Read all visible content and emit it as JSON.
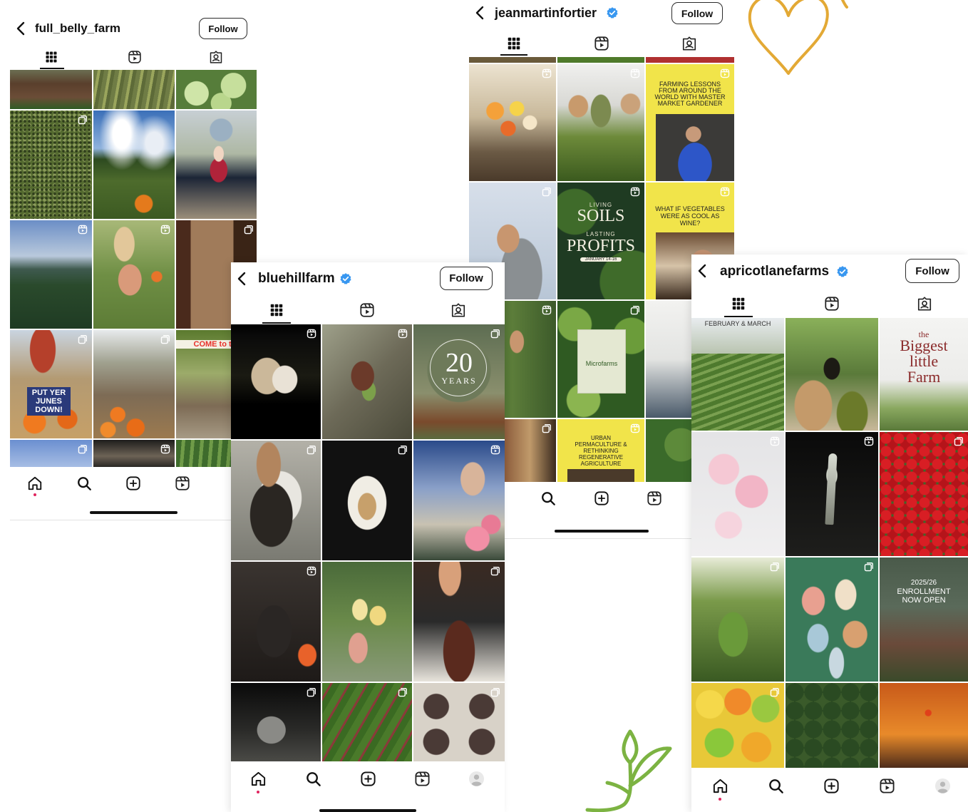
{
  "phones": {
    "full_belly_farm": {
      "username": "full_belly_farm",
      "follow_label": "Follow",
      "verified": false
    },
    "bluehillfarm": {
      "username": "bluehillfarm",
      "follow_label": "Follow",
      "verified": true
    },
    "jeanmartinfortier": {
      "username": "jeanmartinfortier",
      "follow_label": "Follow",
      "verified": true
    },
    "apricotlanefarms": {
      "username": "apricotlanefarms",
      "follow_label": "Follow",
      "verified": true
    }
  },
  "post_text": {
    "full_belly_tile10": "PUT YER JUNES DOWN!",
    "full_belly_tile12": "COME to the",
    "blue_20": "20",
    "blue_years": "YEARS",
    "jmf_farming": "FARMING LESSONS FROM AROUND THE WORLD WITH MASTER MARKET GARDENER",
    "jmf_living": "LIVING",
    "jmf_soils": "SOILS",
    "jmf_lasting": "LASTING",
    "jmf_profits": "PROFITS",
    "jmf_january": "JANUARY 14-16",
    "jmf_whatif": "WHAT IF VEGETABLES WERE AS COOL AS WINE?",
    "jmf_microfarms": "Microfarms",
    "jmf_urban": "URBAN PERMACULTURE & RETHINKING REGENERATIVE AGRICULTURE",
    "apl_feb": "FEBRUARY & MARCH",
    "apl_the": "the",
    "apl_biggest": "Biggest",
    "apl_little": "little",
    "apl_farm": "Farm",
    "apl_year": "2025/26",
    "apl_enroll1": "ENROLLMENT",
    "apl_enroll2": "NOW OPEN"
  },
  "colors": {
    "verified_blue": "#3897f0",
    "notification_red": "#e0245e",
    "heart_stroke": "#e3a935",
    "sprout_stroke": "#7cb342",
    "jmf_yellow": "#f1e44a"
  },
  "icons": [
    "chevron-left-icon",
    "verified-badge-icon",
    "grid-icon",
    "reels-icon",
    "tagged-icon",
    "home-icon",
    "search-icon",
    "create-icon",
    "profile-avatar-icon",
    "reel-badge-icon",
    "carousel-badge-icon"
  ]
}
